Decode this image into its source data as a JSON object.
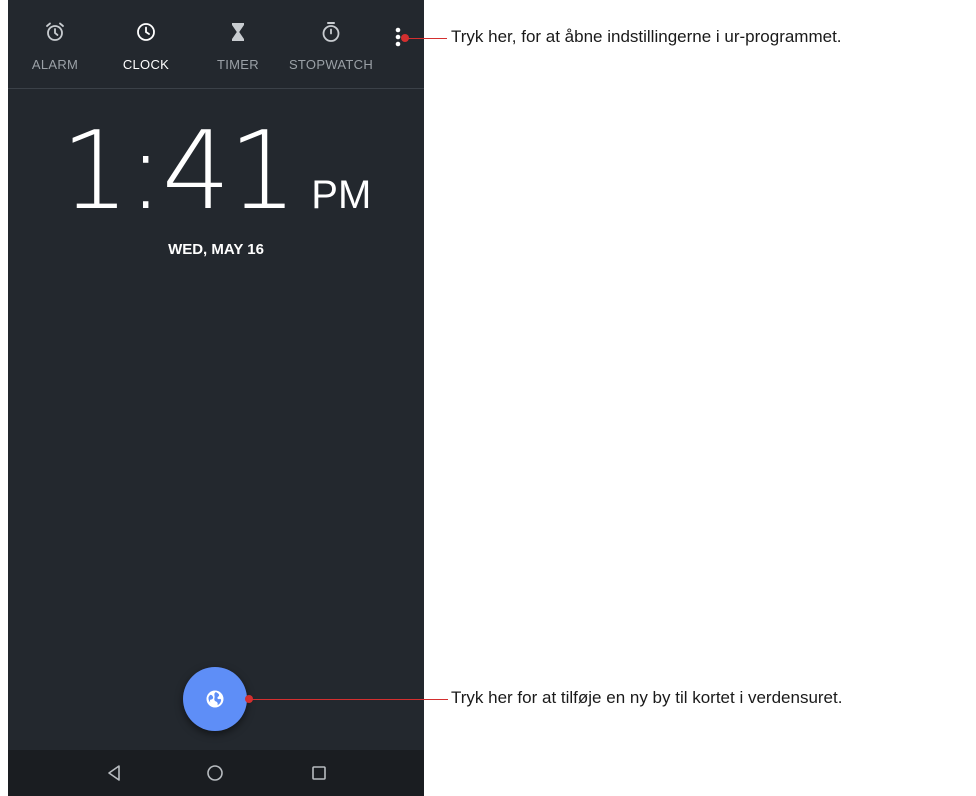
{
  "tabs": [
    {
      "label": "ALARM",
      "icon": "alarm-icon",
      "active": false
    },
    {
      "label": "CLOCK",
      "icon": "clock-icon",
      "active": true
    },
    {
      "label": "TIMER",
      "icon": "hourglass-icon",
      "active": false
    },
    {
      "label": "STOPWATCH",
      "icon": "stopwatch-icon",
      "active": false
    }
  ],
  "clock": {
    "time": "1:41",
    "ampm": "PM",
    "date": "WED, MAY 16"
  },
  "fab": {
    "icon": "globe-icon"
  },
  "navbar": {
    "buttons": [
      "back-icon",
      "home-icon",
      "recents-icon"
    ]
  },
  "callouts": {
    "settings": "Tryk her, for at åbne indstillingerne i ur-programmet.",
    "add_city": "Tryk her for at tilføje en ny by til kortet i verdensuret."
  },
  "colors": {
    "background": "#23282e",
    "fab": "#5e8ef7",
    "callout": "#d32f2f",
    "navbar": "#1a1d21"
  }
}
